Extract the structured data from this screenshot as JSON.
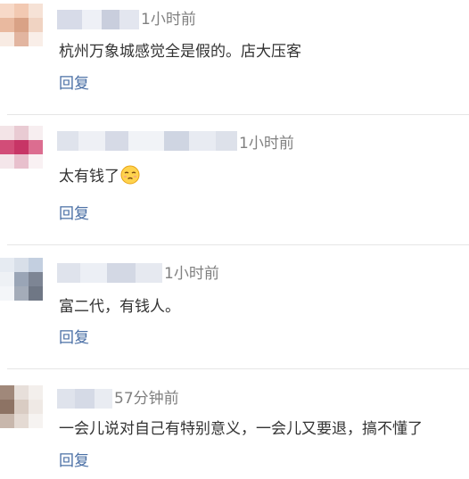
{
  "comments": [
    {
      "time": "1小时前",
      "text": "杭州万象城感觉全是假的。店大压客",
      "reply_label": "回复"
    },
    {
      "time": "1小时前",
      "text": "太有钱了",
      "emoji_icon": "pensive-face-emoji",
      "reply_label": "回复"
    },
    {
      "time": "1小时前",
      "text": "富二代，有钱人。",
      "reply_label": "回复"
    },
    {
      "time": "57分钟前",
      "text": "一会儿说对自己有特别意义，一会儿又要退，搞不懂了",
      "reply_label": "回复"
    }
  ],
  "colors": {
    "timestamp": "#808080",
    "text": "#333333",
    "reply_link": "#4a6fa5",
    "divider": "#e6e6e6"
  }
}
